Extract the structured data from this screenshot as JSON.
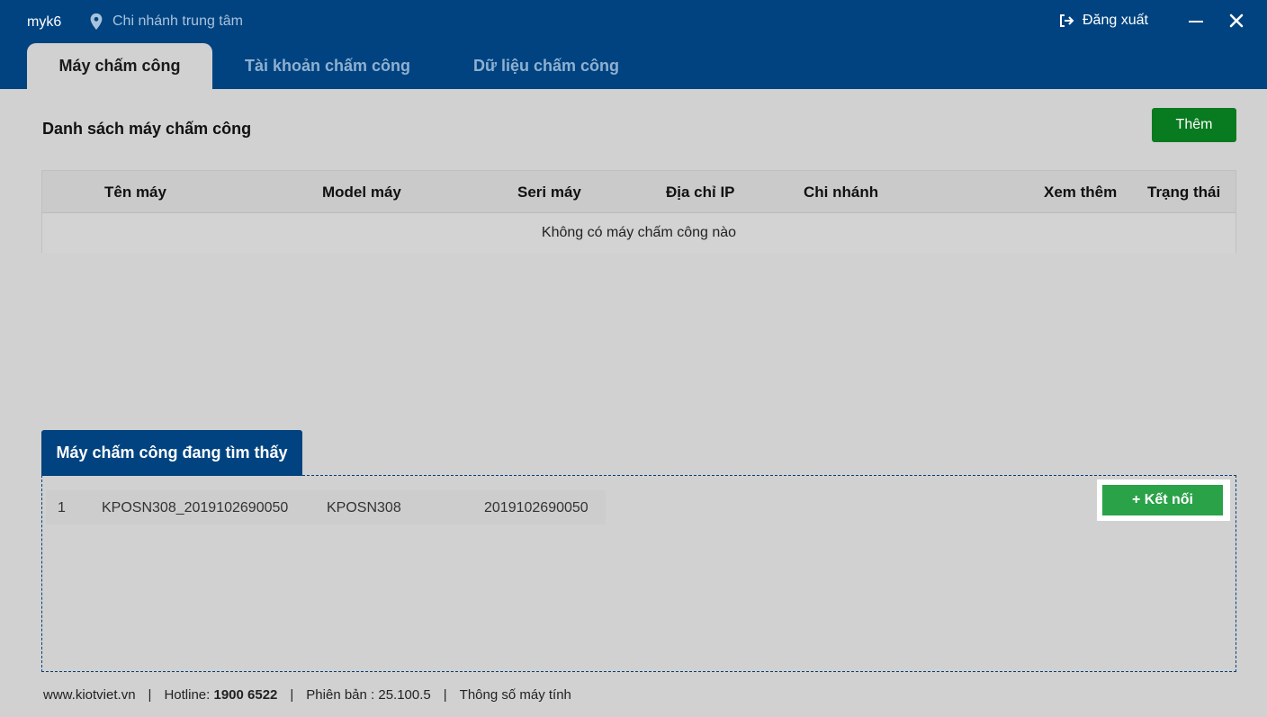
{
  "header": {
    "username": "myk6",
    "branch": "Chi nhánh trung tâm",
    "logout_label": "Đăng xuất"
  },
  "tabs": [
    {
      "label": "Máy chấm công",
      "active": true
    },
    {
      "label": "Tài khoản chấm công",
      "active": false
    },
    {
      "label": "Dữ liệu chấm công",
      "active": false
    }
  ],
  "main": {
    "title": "Danh sách máy chấm công",
    "add_label": "Thêm",
    "table": {
      "columns": [
        "Tên máy",
        "Model máy",
        "Seri máy",
        "Địa chỉ IP",
        "Chi nhánh",
        "Xem thêm",
        "Trạng thái"
      ],
      "empty_text": "Không có máy chấm công nào"
    }
  },
  "found": {
    "title": "Máy chấm công đang tìm thấy",
    "devices": [
      {
        "index": "1",
        "name": "KPOSN308_2019102690050",
        "model": "KPOSN308",
        "serial": "2019102690050"
      }
    ],
    "connect_label": "+ Kết nối"
  },
  "footer": {
    "website": "www.kiotviet.vn",
    "hotline_label": "Hotline: ",
    "hotline_number": "1900 6522",
    "version": "Phiên bản : 25.100.5",
    "specs": "Thông số máy tính"
  },
  "colors": {
    "header_bg": "#004380",
    "add_button": "#087a1f",
    "connect_button": "#2aa248",
    "content_bg": "#d1d1d1"
  }
}
